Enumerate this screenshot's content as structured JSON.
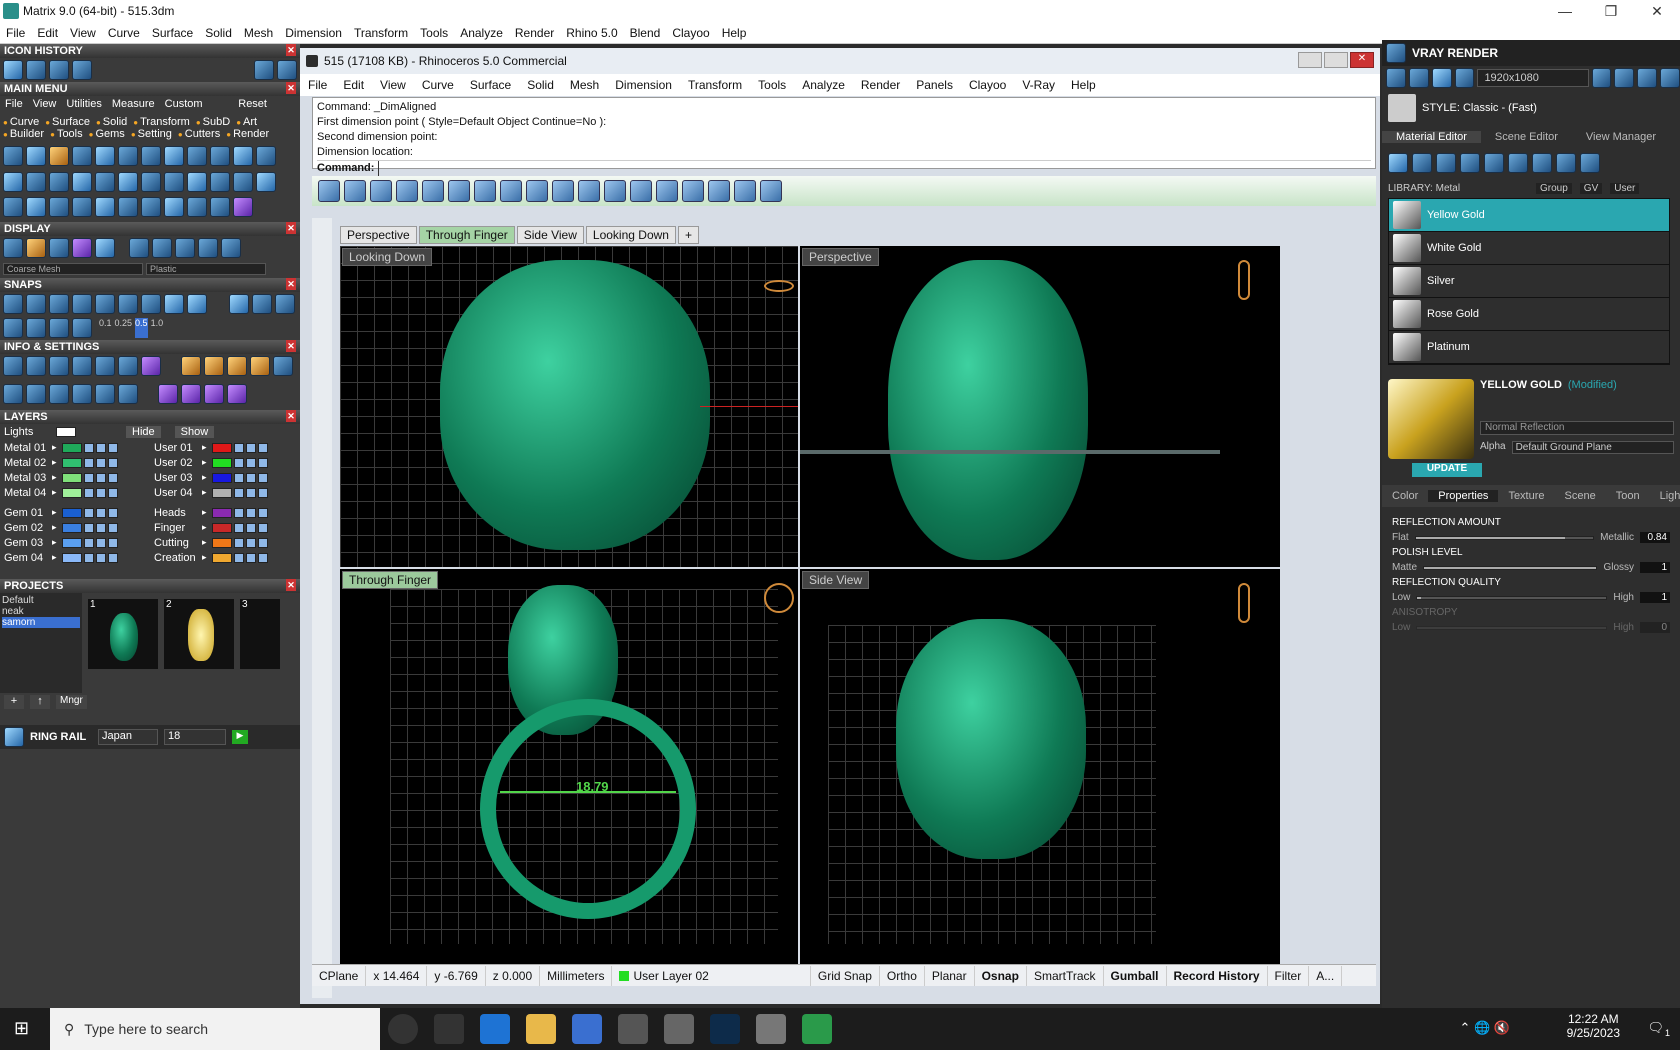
{
  "window": {
    "title": "Matrix 9.0 (64-bit) - 515.3dm"
  },
  "app_menu": [
    "File",
    "Edit",
    "View",
    "Curve",
    "Surface",
    "Solid",
    "Mesh",
    "Dimension",
    "Transform",
    "Tools",
    "Analyze",
    "Render",
    "Rhino 5.0",
    "Blend",
    "Clayoo",
    "Help"
  ],
  "left": {
    "icon_history": "ICON HISTORY",
    "main_menu": "MAIN MENU",
    "menu_tabs": [
      "File",
      "View",
      "Utilities",
      "Measure",
      "Custom",
      "Reset"
    ],
    "categories": [
      "Curve",
      "Surface",
      "Solid",
      "Transform",
      "SubD",
      "Art",
      "Builder",
      "Tools",
      "Gems",
      "Setting",
      "Cutters",
      "Render"
    ],
    "display": "DISPLAY",
    "display_mesh": "Coarse Mesh",
    "display_material": "Plastic",
    "snaps": "SNAPS",
    "snap_values": [
      "0.1",
      "0.25",
      "0.5",
      "1.0"
    ],
    "info_settings": "INFO & SETTINGS",
    "layers": "LAYERS",
    "lights": "Lights",
    "hide": "Hide",
    "show": "Show",
    "layers_left": [
      {
        "name": "Metal 01",
        "color": "#1faa5a"
      },
      {
        "name": "Metal 02",
        "color": "#30c070"
      },
      {
        "name": "Metal 03",
        "color": "#7fe07a"
      },
      {
        "name": "Metal 04",
        "color": "#a0f09a"
      },
      {
        "name": "Gem 01",
        "color": "#1a5fd0"
      },
      {
        "name": "Gem 02",
        "color": "#3a7fe0"
      },
      {
        "name": "Gem 03",
        "color": "#5a9ff0"
      },
      {
        "name": "Gem 04",
        "color": "#8ab8f8"
      }
    ],
    "layers_right": [
      {
        "name": "User 01",
        "color": "#e01818"
      },
      {
        "name": "User 02",
        "color": "#22dd22"
      },
      {
        "name": "User 03",
        "color": "#1818e0"
      },
      {
        "name": "User 04",
        "color": "#b0b0b0"
      },
      {
        "name": "Heads",
        "color": "#8a2ab0"
      },
      {
        "name": "Finger",
        "color": "#c82828"
      },
      {
        "name": "Cutting",
        "color": "#f07818"
      },
      {
        "name": "Creation",
        "color": "#f0a830"
      }
    ],
    "projects": "PROJECTS",
    "project_list": [
      "Default",
      "neak",
      "samorn"
    ],
    "project_thumbs": [
      "1",
      "2",
      "3"
    ],
    "mngr": "Mngr",
    "ring_rail": "RING RAIL",
    "ring_standard": "Japan",
    "ring_size": "18"
  },
  "rhino": {
    "title": "515 (17108 KB) - Rhinoceros 5.0 Commercial",
    "menu": [
      "File",
      "Edit",
      "View",
      "Curve",
      "Surface",
      "Solid",
      "Mesh",
      "Dimension",
      "Transform",
      "Tools",
      "Analyze",
      "Render",
      "Panels",
      "Clayoo",
      "V-Ray",
      "Help"
    ],
    "command_lines": [
      "Command: _DimAligned",
      "First dimension point ( Style=Default  Object  Continue=No ):",
      "Second dimension point:",
      "Dimension location:"
    ],
    "command_prompt": "Command:",
    "viewport_tabs": [
      "Perspective",
      "Through Finger",
      "Side View",
      "Looking Down"
    ],
    "viewports": {
      "top_left": "Looking Down",
      "top_right": "Perspective",
      "bottom_left": "Through Finger",
      "bottom_right": "Side View"
    },
    "dimension": "18.79",
    "status": {
      "cplane": "CPlane",
      "x": "x 14.464",
      "y": "y -6.769",
      "z": "z 0.000",
      "units": "Millimeters",
      "layer": "User Layer 02",
      "items": [
        "Grid Snap",
        "Ortho",
        "Planar",
        "Osnap",
        "SmartTrack",
        "Gumball",
        "Record History",
        "Filter",
        "A..."
      ]
    }
  },
  "right": {
    "vray": "VRAY RENDER",
    "resolution": "1920x1080",
    "style": "STYLE:  Classic - (Fast)",
    "tabs": [
      "Material Editor",
      "Scene Editor",
      "View Manager"
    ],
    "library": "LIBRARY: Metal",
    "library_filters": [
      "Group",
      "GV",
      "User"
    ],
    "materials": [
      "Yellow Gold",
      "White Gold",
      "Silver",
      "Rose Gold",
      "Platinum"
    ],
    "material_name": "YELLOW GOLD",
    "modified": "(Modified)",
    "reflection_mode": "Normal Reflection",
    "update": "UPDATE",
    "alpha": "Alpha",
    "ground_plane": "Default Ground Plane",
    "prop_tabs": [
      "Color",
      "Properties",
      "Texture",
      "Scene",
      "Toon",
      "Lights"
    ],
    "props": [
      {
        "label": "REFLECTION AMOUNT",
        "left": "Flat",
        "right": "Metallic",
        "value": "0.84",
        "fill": 0.84
      },
      {
        "label": "POLISH LEVEL",
        "left": "Matte",
        "right": "Glossy",
        "value": "1",
        "fill": 1
      },
      {
        "label": "REFLECTION QUALITY",
        "left": "Low",
        "right": "High",
        "value": "1",
        "fill": 0.02
      },
      {
        "label": "ANISOTROPY",
        "left": "Low",
        "right": "High",
        "value": "0",
        "fill": 0
      }
    ]
  },
  "taskbar": {
    "search_placeholder": "Type here to search",
    "time": "12:22 AM",
    "date": "9/25/2023",
    "notif": "1"
  }
}
